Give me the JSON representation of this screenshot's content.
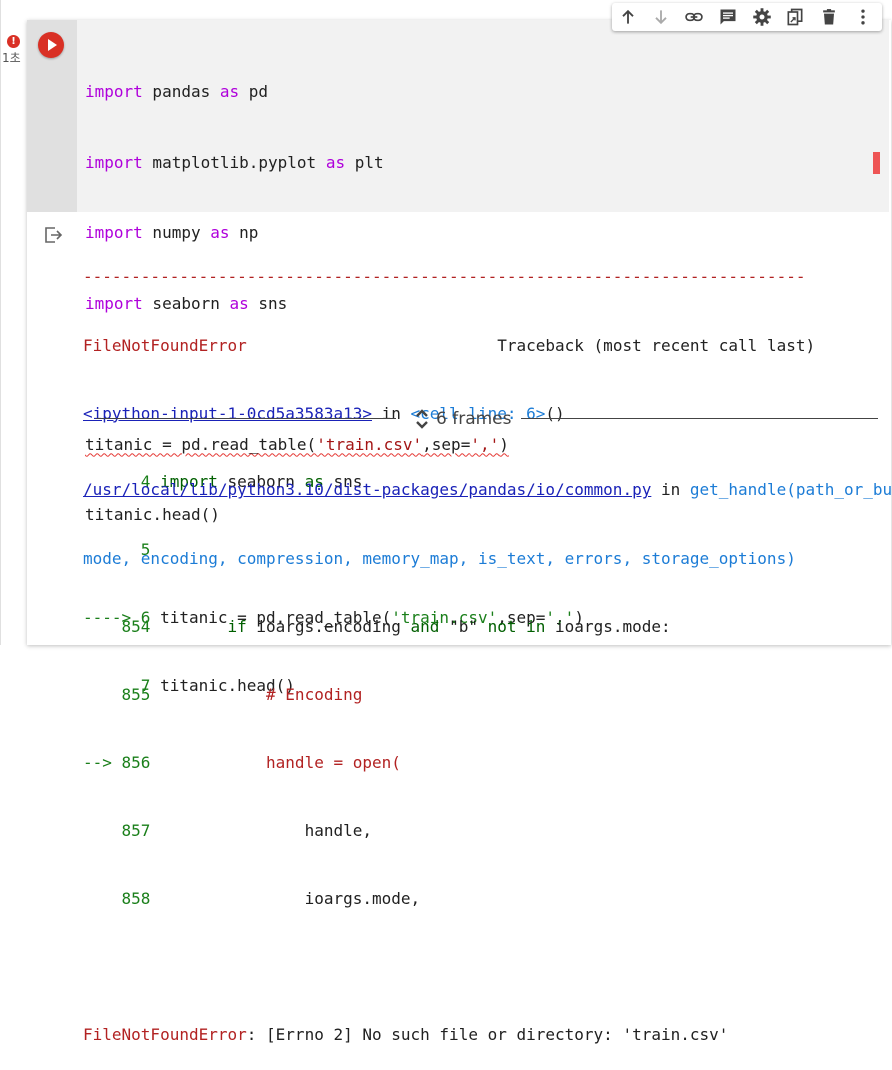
{
  "gutter": {
    "status_badge": "!",
    "exec_time": "1초"
  },
  "toolbar": {
    "icons": [
      "arrow-up-icon",
      "arrow-down-icon",
      "link-icon",
      "comment-icon",
      "gear-icon",
      "mirror-cell-icon",
      "trash-icon",
      "more-vert-icon"
    ]
  },
  "code": {
    "l1": {
      "kw": "import",
      "rest": " pandas ",
      "kw2": "as",
      "rest2": " pd"
    },
    "l2": {
      "kw": "import",
      "rest": " matplotlib.pyplot ",
      "kw2": "as",
      "rest2": " plt"
    },
    "l3": {
      "kw": "import",
      "rest": " numpy ",
      "kw2": "as",
      "rest2": " np"
    },
    "l4": {
      "kw": "import",
      "rest": " seaborn ",
      "kw2": "as",
      "rest2": " sns"
    },
    "l6": {
      "a": "titanic = pd.read_table(",
      "s1": "'train.csv'",
      "b": ",sep=",
      "s2": "','",
      "c": ")"
    },
    "l7": "titanic.head()"
  },
  "output": {
    "dashes": "---------------------------------------------------------------------------",
    "error_name": "FileNotFoundError",
    "traceback_header": "                          Traceback (most recent call last)",
    "input_link": "<ipython-input-1-0cd5a3583a13>",
    "in_text": " in ",
    "cell_line": "<cell line: 6>",
    "cell_line_suffix": "()",
    "ctx": [
      {
        "arrow": "      ",
        "num": "4",
        "code_kw": "import",
        "code_rest": " seaborn ",
        "code_kw2": "as",
        "code_rest2": " sns"
      },
      {
        "arrow": "      ",
        "num": "5"
      },
      {
        "arrow": "----> ",
        "num": "6",
        "code_plain": " titanic = pd.read_table(",
        "s1": "'train.csv'",
        "b": ",sep=",
        "s2": "','",
        "c": ")"
      },
      {
        "arrow": "      ",
        "num": "7",
        "code_plain": " titanic.head()"
      }
    ],
    "frames_label": "6 frames",
    "file_link": "/usr/local/lib/python3.10/dist-packages/pandas/io/common.py",
    "in_text2": " in ",
    "func_name": "get_handle",
    "func_args_1": "(path_or_buf,",
    "func_args_2": "mode, encoding, compression, memory_map, is_text, errors, storage_options)",
    "frame_lines": [
      {
        "arrow": "    ",
        "num": "854",
        "pre": "        ",
        "kw": "if",
        "mid": " ioargs.encoding ",
        "kw2": "and",
        "s": " \"b\" ",
        "kw3": "not in",
        "post": " ioargs.mode:"
      },
      {
        "arrow": "    ",
        "num": "855",
        "comment": "            # Encoding"
      },
      {
        "arrow": "--> ",
        "num": "856",
        "red": "            handle = open("
      },
      {
        "arrow": "    ",
        "num": "857",
        "plain": "                handle,"
      },
      {
        "arrow": "    ",
        "num": "858",
        "plain": "                ioargs.mode,"
      }
    ],
    "final_error_name": "FileNotFoundError",
    "final_error_msg": ": [Errno 2] No such file or directory: 'train.csv'"
  }
}
